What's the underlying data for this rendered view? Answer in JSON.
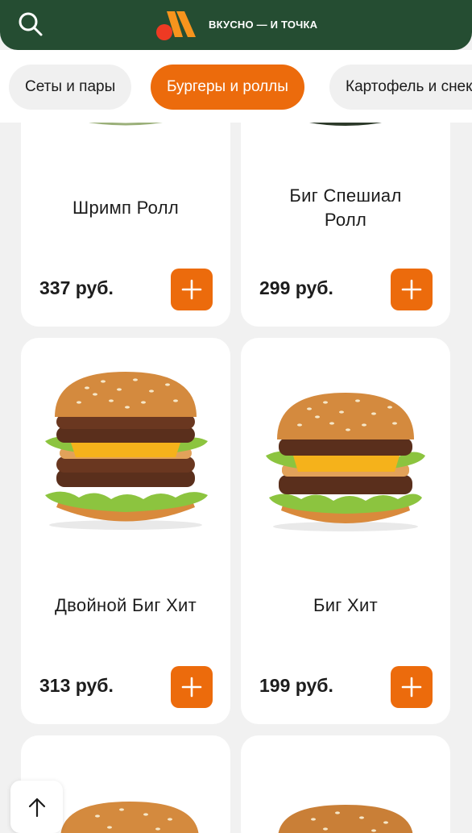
{
  "header": {
    "brand_text": "ВКУСНО — И ТОЧКА",
    "search_icon": "search-icon",
    "colors": {
      "header_bg": "#254d32",
      "accent": "#ec6b0c",
      "logo_dot": "#ee3a23"
    }
  },
  "tabs": [
    {
      "label": "Сеты и пары",
      "active": false
    },
    {
      "label": "Бургеры и роллы",
      "active": true
    },
    {
      "label": "Картофель и снеки",
      "active": false
    }
  ],
  "products": [
    {
      "title": "Шримп Ролл",
      "price": "337 руб.",
      "add_icon": "plus-icon"
    },
    {
      "title": "Биг Спешиал Ролл",
      "price": "299 руб.",
      "add_icon": "plus-icon"
    },
    {
      "title": "Двойной Биг Хит",
      "price": "313 руб.",
      "add_icon": "plus-icon"
    },
    {
      "title": "Биг Хит",
      "price": "199 руб.",
      "add_icon": "plus-icon"
    }
  ],
  "scroll_top_icon": "arrow-up-icon"
}
